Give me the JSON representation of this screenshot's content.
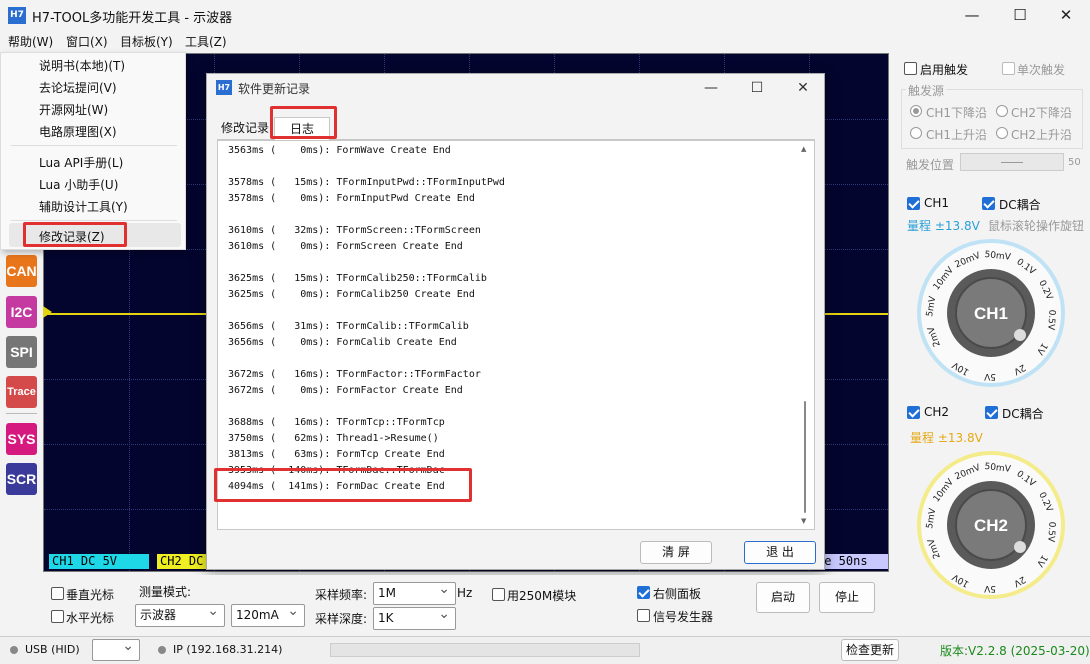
{
  "window": {
    "icon_text": "H7",
    "title": "H7-TOOL多功能开发工具 - 示波器",
    "minimize": "—",
    "maximize": "☐",
    "close": "✕"
  },
  "menubar": [
    "帮助(W)",
    "窗口(X)",
    "目标板(Y)",
    "工具(Z)"
  ],
  "help_menu": {
    "items": [
      "说明书(本地)(T)",
      "去论坛提问(V)",
      "开源网址(W)",
      "电路原理图(X)",
      "Lua API手册(L)",
      "Lua 小助手(U)",
      "辅助设计工具(Y)",
      "修改记录(Z)"
    ],
    "highlighted": "修改记录(Z)"
  },
  "side_buttons": [
    {
      "label": "CAN",
      "color": "#e8751a"
    },
    {
      "label": "I2C",
      "color": "#c43aa0"
    },
    {
      "label": "SPI",
      "color": "#767676"
    },
    {
      "label": "Trace",
      "color": "#d44a4a"
    },
    {
      "label": "SYS",
      "color": "#d6197e"
    },
    {
      "label": "SCR",
      "color": "#3a3a9a"
    }
  ],
  "scope": {
    "ch1_status": "CH1  DC    5V",
    "ch2_status": "CH2  DC",
    "time_status": "ge   50ns",
    "trace_color": "#e6d310"
  },
  "dialog": {
    "icon_text": "H7",
    "title": "软件更新记录",
    "tabs": [
      "修改记录",
      "日志"
    ],
    "active_tab": "日志",
    "log_lines": [
      "3563ms (    0ms): FormWave Create End",
      "",
      "3578ms (   15ms): TFormInputPwd::TFormInputPwd",
      "3578ms (    0ms): FormInputPwd Create End",
      "",
      "3610ms (   32ms): TFormScreen::TFormScreen",
      "3610ms (    0ms): FormScreen Create End",
      "",
      "3625ms (   15ms): TFormCalib250::TFormCalib",
      "3625ms (    0ms): FormCalib250 Create End",
      "",
      "3656ms (   31ms): TFormCalib::TFormCalib",
      "3656ms (    0ms): FormCalib Create End",
      "",
      "3672ms (   16ms): TFormFactor::TFormFactor",
      "3672ms (    0ms): FormFactor Create End",
      "",
      "3688ms (   16ms): TFormTcp::TFormTcp",
      "3750ms (   62ms): Thread1->Resume()",
      "3813ms (   63ms): FormTcp Create End",
      "3953ms (  140ms): TFormDac::TFormDac",
      "4094ms (  141ms): FormDac Create End"
    ],
    "clear_button": "清 屏",
    "exit_button": "退 出"
  },
  "right_panel": {
    "enable_trigger": "启用触发",
    "single_trigger": "单次触发",
    "trigger_source_title": "触发源",
    "sources": [
      "CH1下降沿",
      "CH2下降沿",
      "CH1上升沿",
      "CH2上升沿"
    ],
    "selected_source": "CH1下降沿",
    "trigger_position_label": "触发位置",
    "trigger_position_value": "50",
    "ch1": {
      "label": "CH1",
      "dc_label": "DC耦合",
      "range_label": "量程 ±13.8V",
      "hint": "鼠标滚轮操作旋钮",
      "knob_label": "CH1",
      "color": "#2aa0d8"
    },
    "ch2": {
      "label": "CH2",
      "dc_label": "DC耦合",
      "range_label": "量程 ±13.8V",
      "knob_label": "CH2",
      "color": "#e6a817"
    },
    "knob_ticks": [
      "2mV",
      "5mV",
      "10mV",
      "20mV",
      "50mV",
      "0.1V",
      "0.2V",
      "0.5V",
      "1V",
      "2V",
      "5V",
      "10V"
    ]
  },
  "bottom": {
    "vertical_cursor": "垂直光标",
    "horizontal_cursor": "水平光标",
    "measure_mode_label": "测量模式:",
    "measure_mode_value": "示波器",
    "current_range": "120mA",
    "sample_rate_label": "采样频率:",
    "sample_rate_value": "1M",
    "sample_rate_unit": "Hz",
    "sample_depth_label": "采样深度:",
    "sample_depth_value": "1K",
    "use_250m": "用250M模块",
    "right_panel_cb": "右侧面板",
    "signal_gen_cb": "信号发生器",
    "start_button": "启动",
    "stop_button": "停止"
  },
  "statusbar": {
    "connection": "USB (HID)",
    "ip": "IP (192.168.31.214)",
    "check_update": "检查更新",
    "version": "版本:V2.2.8 (2025-03-20)",
    "version_color": "#1a8a1a"
  }
}
